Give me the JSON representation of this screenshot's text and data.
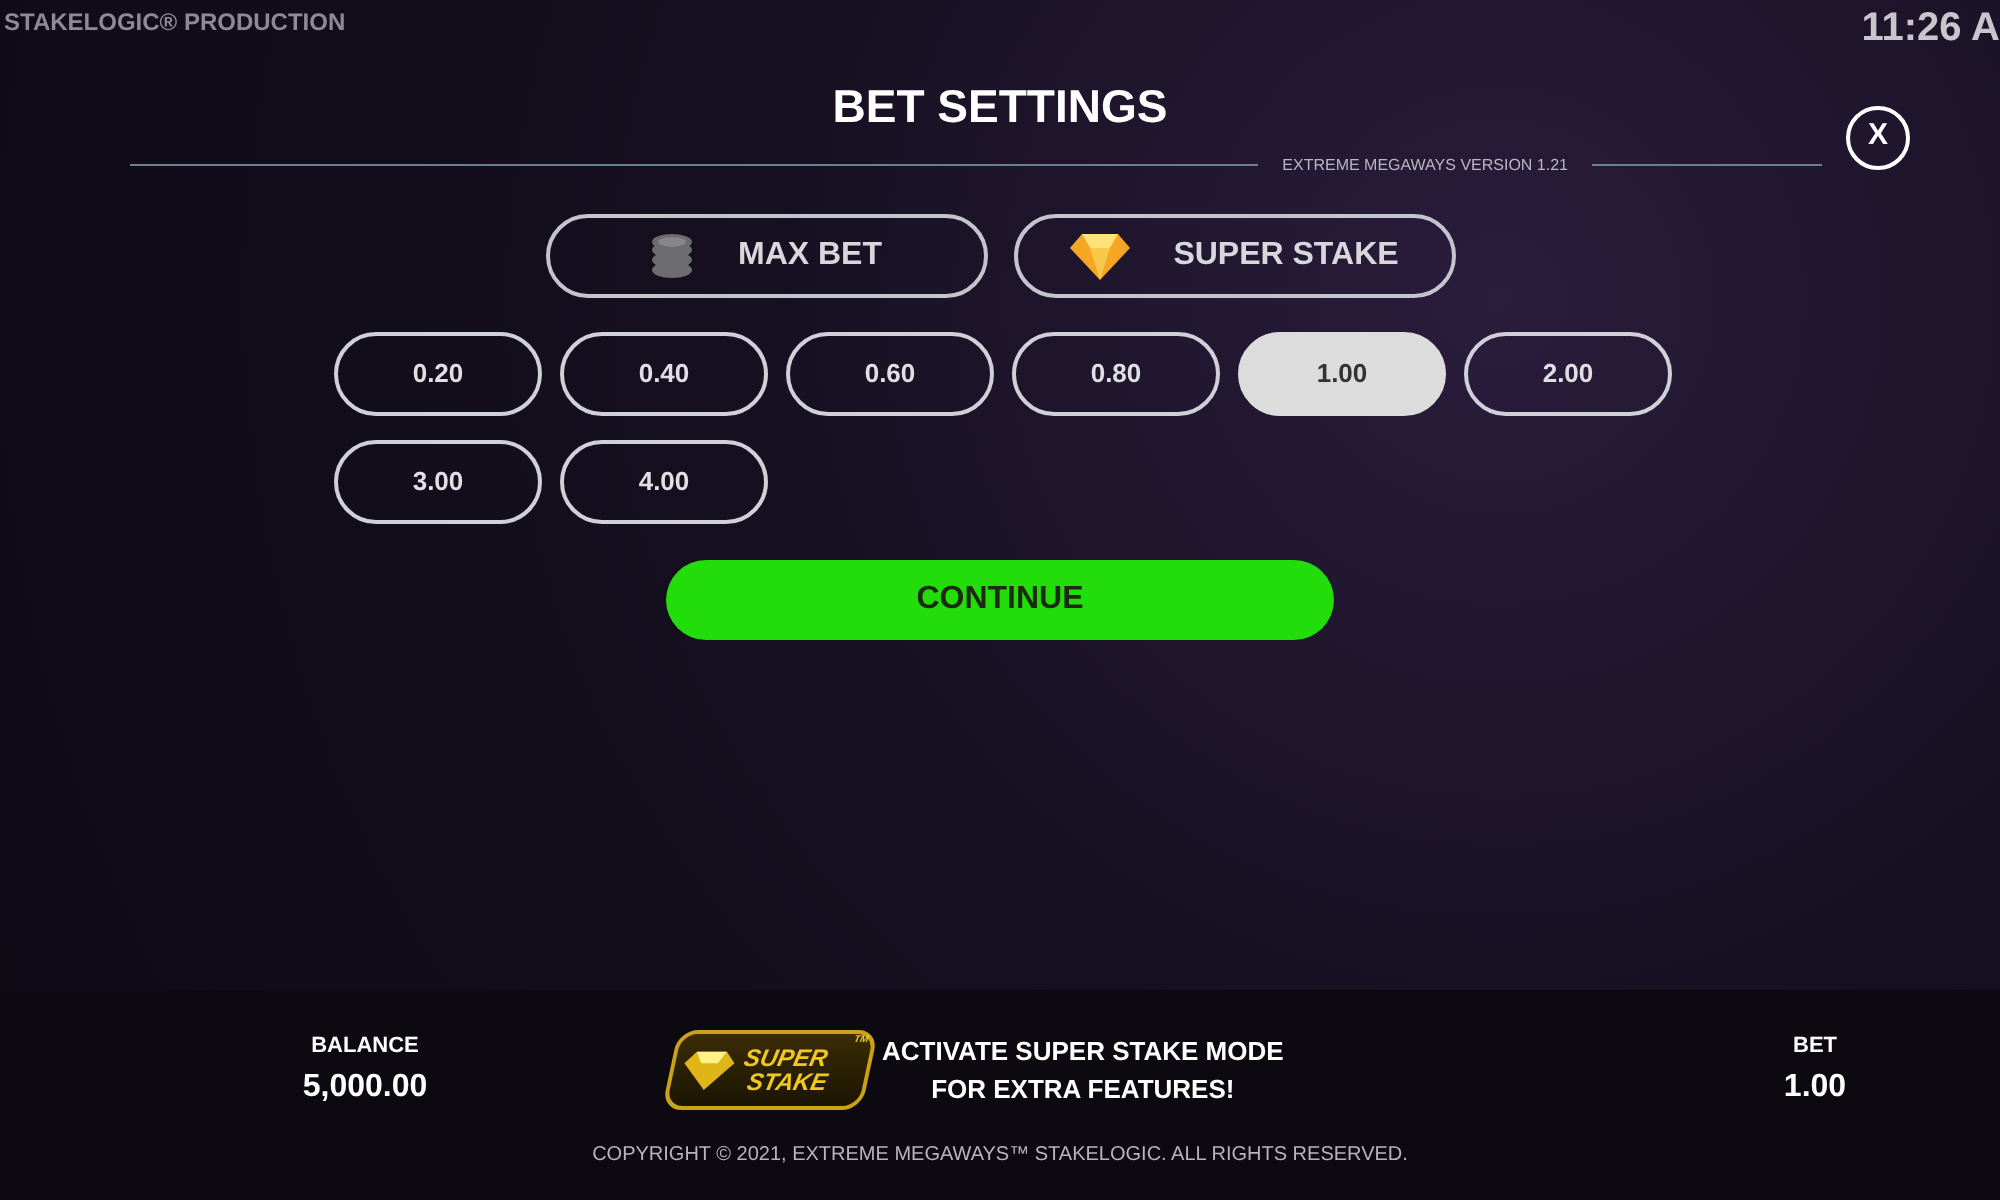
{
  "top_bar": {
    "brand": "STAKELOGIC® PRODUCTION",
    "clock": "11:26 A"
  },
  "header": {
    "title": "BET SETTINGS",
    "version": "EXTREME MEGAWAYS VERSION 1.21",
    "close": "X"
  },
  "options": [
    {
      "kind": "coins",
      "label": "MAX BET"
    },
    {
      "kind": "gem",
      "label": "SUPER STAKE"
    }
  ],
  "bets": [
    {
      "label": "0.20",
      "selected": false
    },
    {
      "label": "0.40",
      "selected": false
    },
    {
      "label": "0.60",
      "selected": false
    },
    {
      "label": "0.80",
      "selected": false
    },
    {
      "label": "1.00",
      "selected": true
    },
    {
      "label": "2.00",
      "selected": false
    },
    {
      "label": "3.00",
      "selected": false
    },
    {
      "label": "4.00",
      "selected": false
    }
  ],
  "continue": "CONTINUE",
  "footer": {
    "balance_label": "BALANCE",
    "balance": "5,000.00",
    "logo": [
      "SUPER",
      "STAKE",
      "TM"
    ],
    "promo": [
      "ACTIVATE SUPER STAKE MODE",
      "FOR EXTRA FEATURES!"
    ],
    "bet_label": "BET",
    "bet": "1.00",
    "copyright": "COPYRIGHT © 2021, EXTREME MEGAWAYS™ STAKELOGIC. ALL RIGHTS RESERVED."
  }
}
